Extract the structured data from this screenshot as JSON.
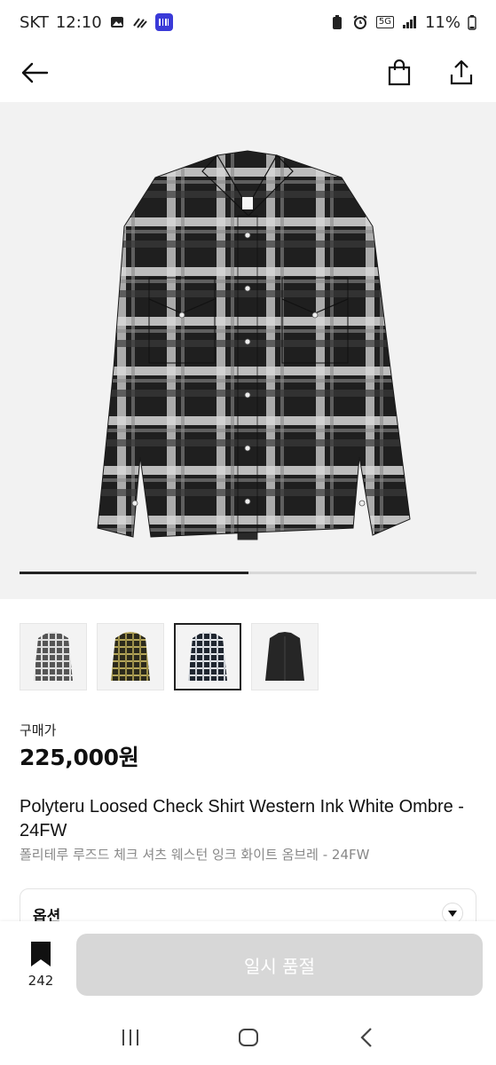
{
  "status_bar": {
    "carrier": "SKT",
    "time": "12:10",
    "network": "5G",
    "battery": "11%",
    "left_icons": [
      "image-icon",
      "signal-wave-icon",
      "app-badge-icon"
    ],
    "right_icons": [
      "battery-saver-icon",
      "alarm-icon",
      "network-5g-icon",
      "signal-bars-icon",
      "battery-icon"
    ]
  },
  "top_nav": {
    "icons": [
      "back-arrow-icon",
      "shopping-bag-icon",
      "share-icon"
    ]
  },
  "hero": {
    "image_position": 1,
    "image_count": 2,
    "progress": 0.5
  },
  "thumbnails": [
    {
      "name": "thumb-1",
      "variant": "grey check",
      "selected": false
    },
    {
      "name": "thumb-2",
      "variant": "olive check",
      "selected": false
    },
    {
      "name": "thumb-3",
      "variant": "ink white check",
      "selected": true
    },
    {
      "name": "thumb-4",
      "variant": "black",
      "selected": false
    }
  ],
  "product": {
    "price_label": "구매가",
    "price": "225,000원",
    "title_en": "Polyteru Loosed Check Shirt Western Ink White Ombre - 24FW",
    "title_ko": "폴리테루 루즈드 체크 셔츠 웨스턴 잉크 화이트 옴브레 - 24FW"
  },
  "option": {
    "label": "옵션"
  },
  "bottom_bar": {
    "bookmark_count": "242",
    "soldout_label": "일시 품절"
  },
  "system_nav": {
    "icons": [
      "recent-apps-icon",
      "home-icon",
      "back-icon"
    ]
  },
  "colors": {
    "accent": "#111111",
    "soldout_button": "#d7d7d7",
    "hero_bg": "#f2f2f2",
    "subtext": "#888888"
  }
}
